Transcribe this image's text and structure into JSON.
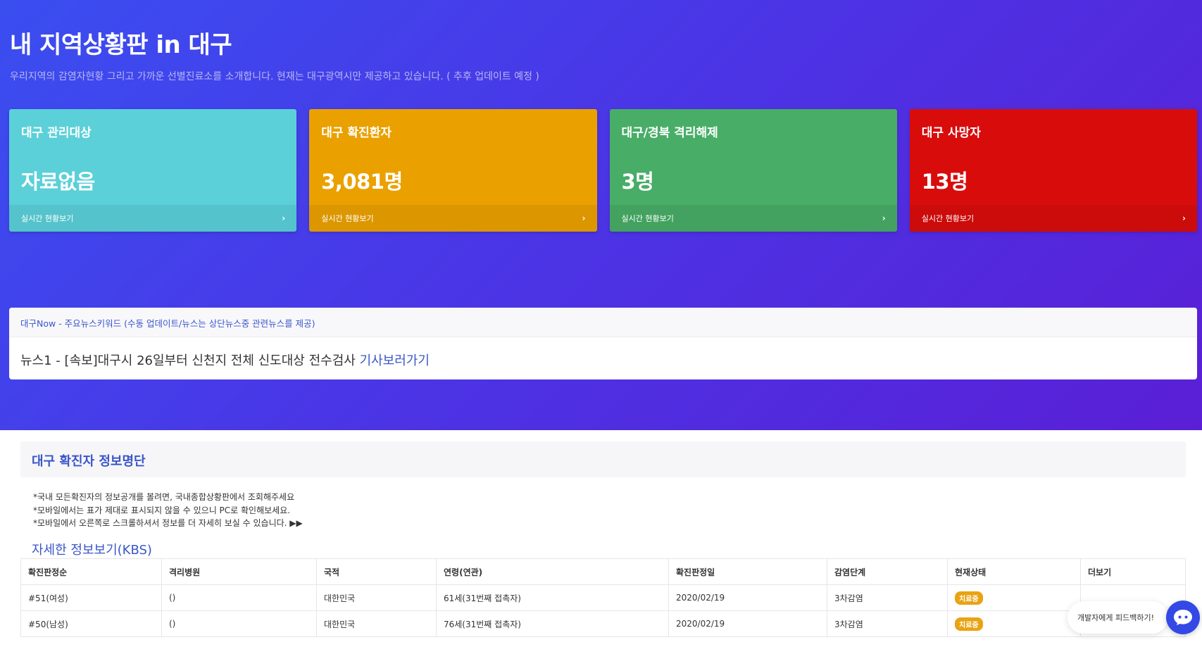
{
  "header": {
    "title": "내 지역상황판 in 대구",
    "subtitle": "우리지역의 감염자현황 그리고 가까운 선별진료소를 소개합니다. 현재는 대구광역시만 제공하고 있습니다. ( 추후 업데이트 예정 )"
  },
  "colors": {
    "card1": "#5bd0d8",
    "card2": "#eaa100",
    "card3": "#48ad67",
    "card4": "#d90c0c",
    "accent": "#3a56c9"
  },
  "cards": [
    {
      "title": "대구 관리대상",
      "value": "자료없음",
      "link": "실시간 현황보기",
      "chevron": "›"
    },
    {
      "title": "대구 확진환자",
      "value": "3,081명",
      "link": "실시간 현황보기",
      "chevron": "›"
    },
    {
      "title": "대구/경북 격리해제",
      "value": "3명",
      "link": "실시간 현황보기",
      "chevron": "›"
    },
    {
      "title": "대구 사망자",
      "value": "13명",
      "link": "실시간 현황보기",
      "chevron": "›"
    }
  ],
  "news": {
    "header": "대구Now - 주요뉴스키워드 (수동 업데이트/뉴스는 상단뉴스중 관련뉴스를 제공)",
    "item_text": "뉴스1 - [속보]대구시 26일부터 신천지 전체 신도대상 전수검사 ",
    "item_link": "기사보러가기"
  },
  "section": {
    "title": "대구 확진자 정보명단",
    "notes": [
      "*국내 모든확진자의 정보공개를 볼려면, 국내종합상황판에서 조회해주세요",
      "*모바일에서는 표가 제대로 표시되지 않을 수 있으니 PC로 확인해보세요.",
      "*모바일에서 오른쪽로 스크롤하셔서 정보를 더 자세히 보실 수 있습니다. ▶▶"
    ],
    "kbs_link": "자세한 정보보기(KBS)"
  },
  "table": {
    "headers": [
      "확진판정순",
      "격리병원",
      "국적",
      "연령(연관)",
      "확진판정일",
      "감염단계",
      "현재상태",
      "더보기"
    ],
    "rows": [
      [
        "#51(여성)",
        "()",
        "대한민국",
        "61세(31번째 접촉자)",
        "2020/02/19",
        "3차감염",
        "치료중",
        ""
      ],
      [
        "#50(남성)",
        "()",
        "대한민국",
        "76세(31번째 접촉자)",
        "2020/02/19",
        "3차감염",
        "치료중",
        ""
      ]
    ]
  },
  "feedback": {
    "label": "개발자에게 피드백하기!"
  },
  "icons": {
    "chat": "chat-bubble-icon"
  }
}
